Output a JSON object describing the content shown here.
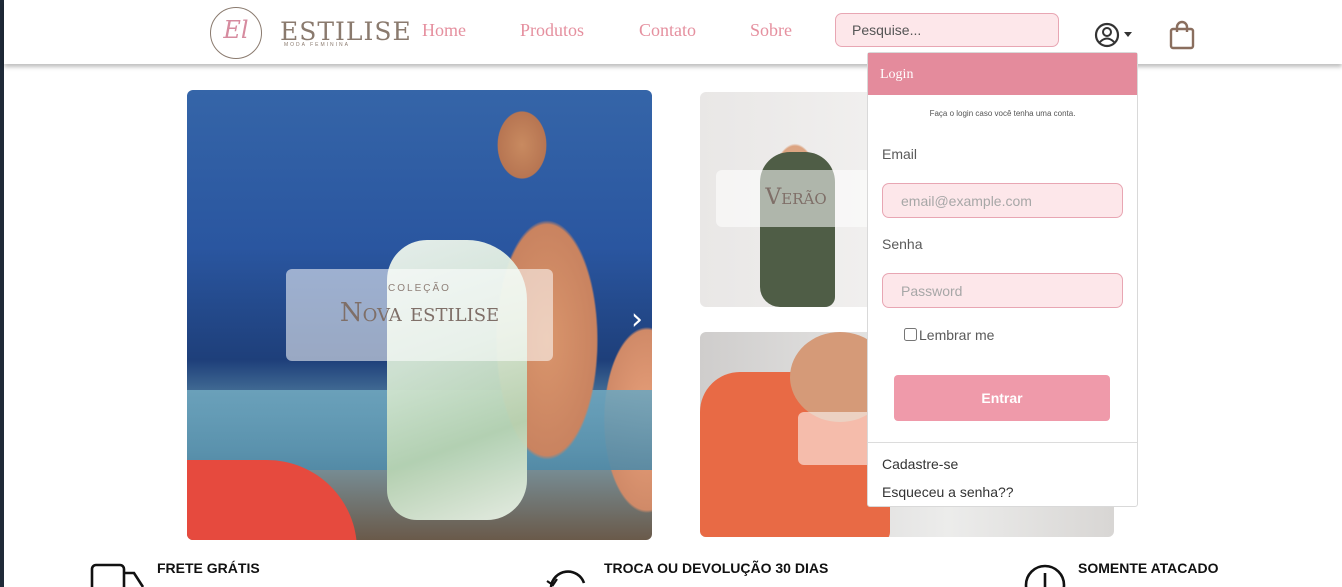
{
  "header": {
    "logo": {
      "monogram": "El",
      "brand": "ESTILISE",
      "tagline": "MODA FEMININA"
    },
    "nav": [
      "Home",
      "Produtos",
      "Contato",
      "Sobre"
    ],
    "search_placeholder": "Pesquise...",
    "icons": [
      "user-circle-icon",
      "caret-down-icon",
      "shopping-bag-icon"
    ]
  },
  "hero": {
    "main": {
      "kicker": "COLEÇÃO",
      "title": "Nova estilise"
    },
    "summer": {
      "title": "Verão"
    }
  },
  "login": {
    "title": "Login",
    "note": "Faça o login caso você tenha uma conta.",
    "email_label": "Email",
    "email_placeholder": "email@example.com",
    "password_label": "Senha",
    "password_placeholder": "Password",
    "remember": "Lembrar me",
    "submit": "Entrar",
    "signup": "Cadastre-se",
    "forgot": "Esqueceu a senha??"
  },
  "features": [
    "FRETE GRÁTIS",
    "TROCA OU DEVOLUÇÃO 30 DIAS",
    "SOMENTE ATACADO"
  ],
  "colors": {
    "accent": "#e48b9c",
    "nav_text": "#e5909f",
    "input_bg": "#fde7ea"
  }
}
